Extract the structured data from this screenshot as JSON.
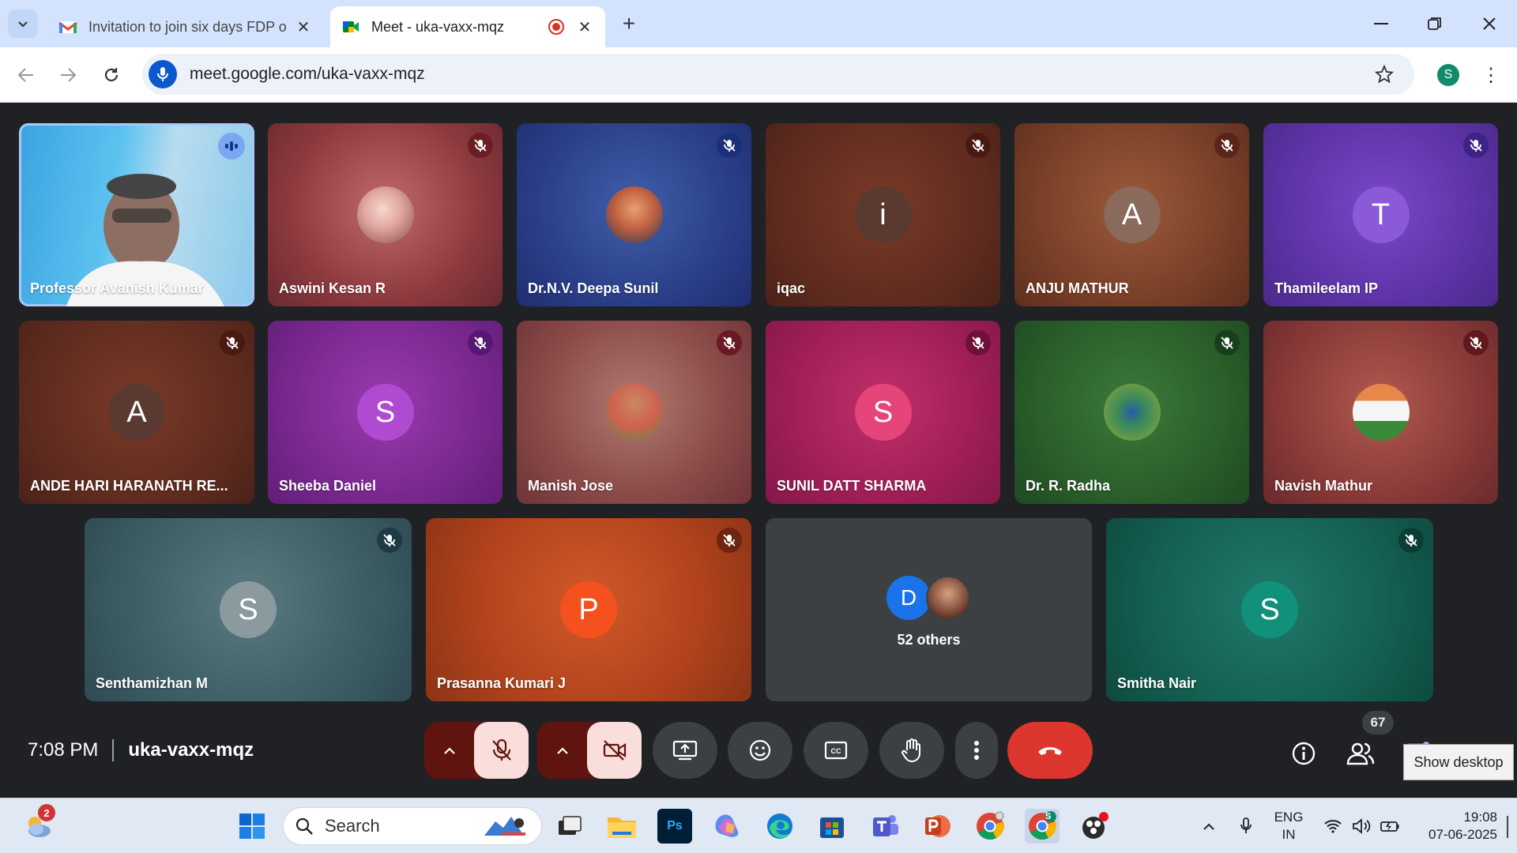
{
  "browser": {
    "tabs": [
      {
        "title": "Invitation to join six days FDP o",
        "favicon": "gmail-icon",
        "active": false
      },
      {
        "title": "Meet - uka-vaxx-mqz",
        "favicon": "meet-icon",
        "active": true,
        "recording": true
      }
    ],
    "url": "meet.google.com/uka-vaxx-mqz",
    "profile_initial": "S"
  },
  "meet": {
    "time": "7:08 PM",
    "meeting_code": "uka-vaxx-mqz",
    "participant_count": "67",
    "tiles": [
      {
        "name": "Professor Avanish Kumar",
        "type": "video",
        "muted": false
      },
      {
        "name": "Aswini Kesan R",
        "type": "photo",
        "muted": true
      },
      {
        "name": "Dr.N.V. Deepa Sunil",
        "type": "photo",
        "muted": true
      },
      {
        "name": "iqac",
        "initial": "i",
        "muted": true
      },
      {
        "name": "ANJU MATHUR",
        "initial": "A",
        "muted": true
      },
      {
        "name": "Thamileelam IP",
        "initial": "T",
        "muted": true
      },
      {
        "name": "ANDE HARI HARANATH RE...",
        "initial": "A",
        "muted": true
      },
      {
        "name": "Sheeba Daniel",
        "initial": "S",
        "muted": true
      },
      {
        "name": "Manish Jose",
        "type": "photo",
        "muted": true
      },
      {
        "name": "SUNIL DATT SHARMA",
        "initial": "S",
        "muted": true
      },
      {
        "name": "Dr. R. Radha",
        "type": "photo",
        "muted": true
      },
      {
        "name": "Navish Mathur",
        "type": "photo",
        "muted": true
      },
      {
        "name": "Senthamizhan M",
        "initial": "S",
        "muted": true
      },
      {
        "name": "Prasanna Kumari J",
        "initial": "P",
        "muted": true
      },
      {
        "name": "52 others",
        "initial": "D",
        "muted": false
      },
      {
        "name": "Smitha Nair",
        "initial": "S",
        "muted": true
      }
    ],
    "tooltip": "Show desktop"
  },
  "taskbar": {
    "search_placeholder": "Search",
    "weather_badge": "2",
    "language": "ENG",
    "region": "IN",
    "time": "19:08",
    "date": "07-06-2025",
    "apps": [
      "windows-start-icon",
      "search-icon",
      "task-view-icon",
      "file-explorer-icon",
      "photoshop-icon",
      "copilot-icon",
      "edge-icon",
      "store-icon",
      "teams-icon",
      "powerpoint-icon",
      "chrome-icon",
      "chrome-profile-icon",
      "obs-icon"
    ],
    "photoshop_label": "Ps",
    "chrome_profile_initial": "S"
  },
  "colors": {
    "meet_bg": "#202124",
    "end_call": "#dc362e",
    "mute_tile_bg": "#f9dedc"
  }
}
